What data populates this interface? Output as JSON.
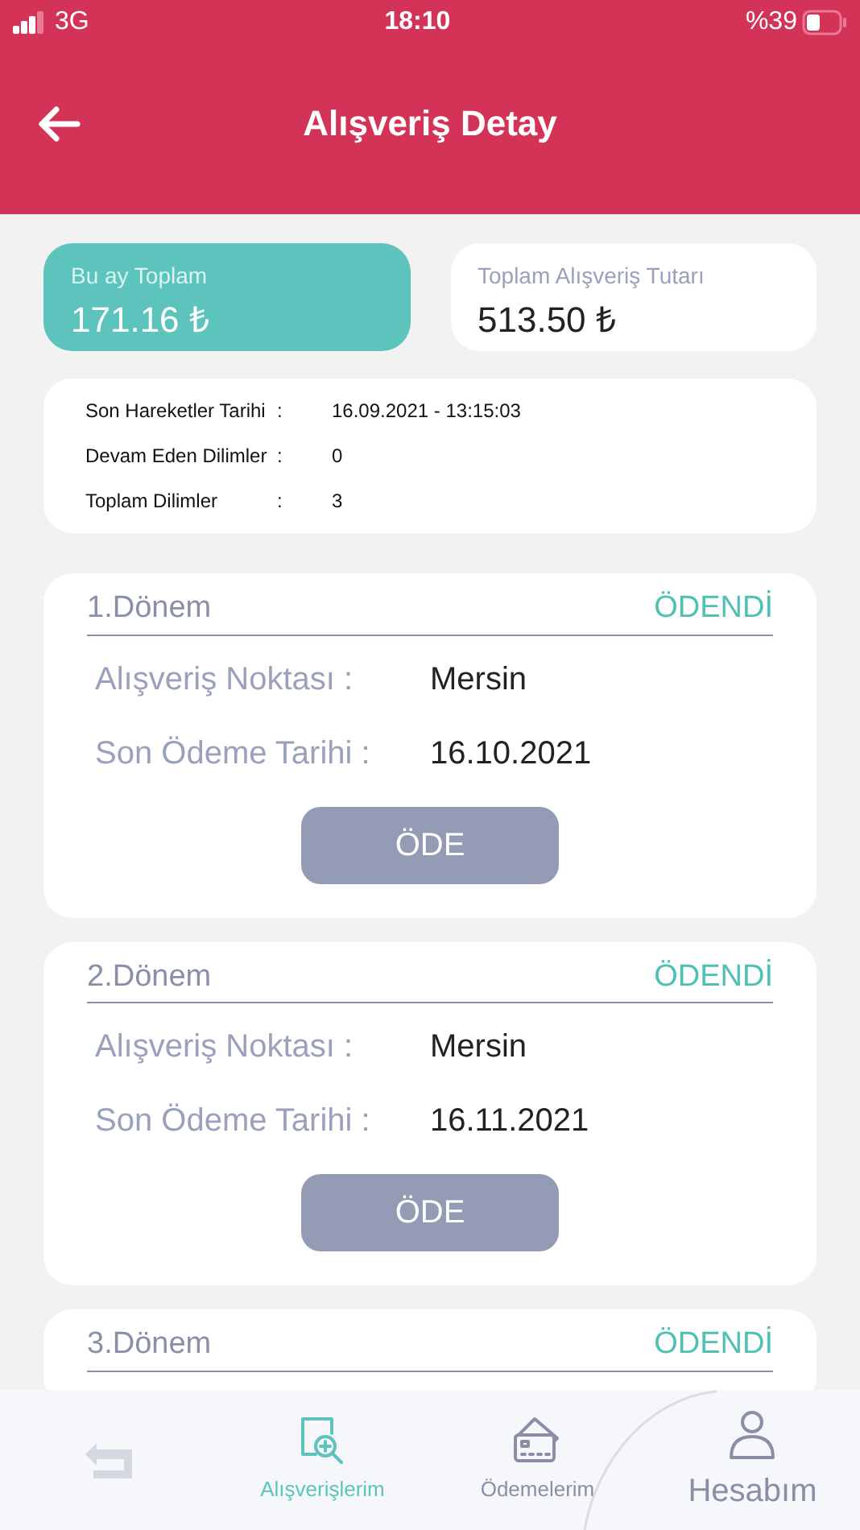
{
  "status_bar": {
    "carrier": "3G",
    "time": "18:10",
    "battery": "%39"
  },
  "header": {
    "title": "Alışveriş Detay"
  },
  "summary": [
    {
      "label": "Bu ay Toplam",
      "amount": "171.16 ₺",
      "highlighted": true
    },
    {
      "label": "Toplam Alışveriş Tutarı",
      "amount": "513.50 ₺",
      "highlighted": false
    }
  ],
  "info": [
    {
      "label": "Son Hareketler Tarihi",
      "separator": ":",
      "value": "16.09.2021 - 13:15:03"
    },
    {
      "label": "Devam Eden Dilimler",
      "separator": ":",
      "value": "0"
    },
    {
      "label": "Toplam Dilimler",
      "separator": ":",
      "value": "3"
    }
  ],
  "periods": [
    {
      "title": "1.Dönem",
      "status": "ÖDENDİ",
      "fields": [
        {
          "label": "Alışveriş Noktası :",
          "value": "Mersin"
        },
        {
          "label": "Son Ödeme Tarihi :",
          "value": "16.10.2021"
        }
      ],
      "button": "ÖDE"
    },
    {
      "title": "2.Dönem",
      "status": "ÖDENDİ",
      "fields": [
        {
          "label": "Alışveriş Noktası :",
          "value": "Mersin"
        },
        {
          "label": "Son Ödeme Tarihi :",
          "value": "16.11.2021"
        }
      ],
      "button": "ÖDE"
    },
    {
      "title": "3.Dönem",
      "status": "ÖDENDİ"
    }
  ],
  "tab_bar": [
    {
      "kind": "back",
      "selected": false,
      "disabled": true
    },
    {
      "kind": "purchases",
      "label": "Alışverişlerim",
      "selected": true,
      "disabled": false
    },
    {
      "kind": "payments",
      "label": "Ödemelerim",
      "selected": false,
      "disabled": false
    },
    {
      "kind": "account",
      "label": "Hesabım",
      "selected": false,
      "disabled": false
    }
  ]
}
